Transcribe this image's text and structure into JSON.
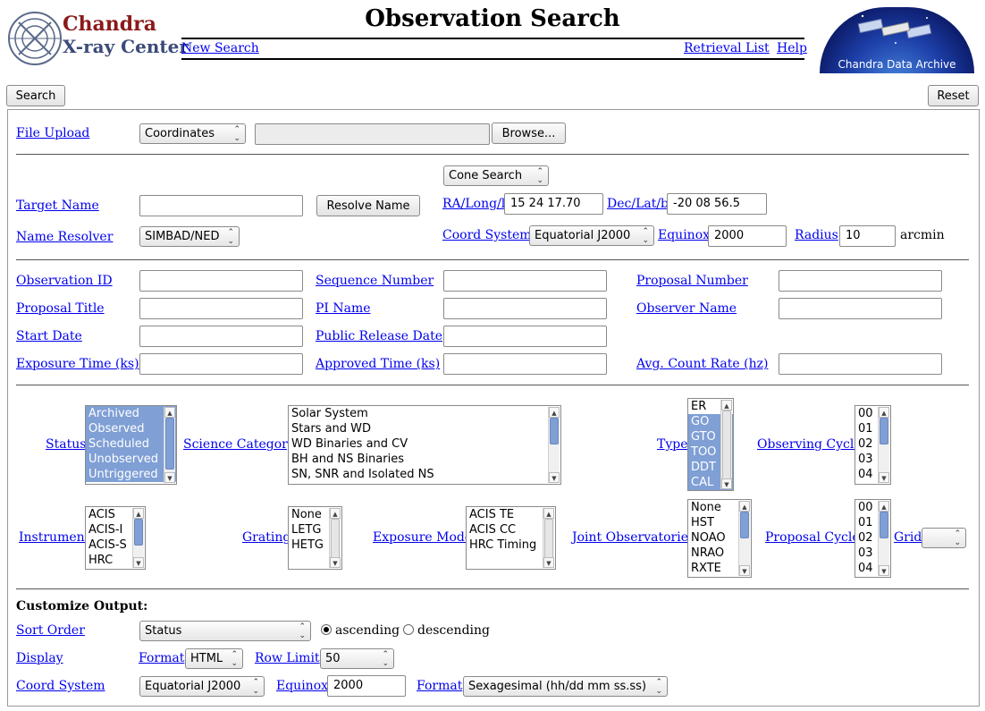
{
  "header": {
    "logo_line1": "Chandra",
    "logo_line2": "X-ray Center",
    "title": "Observation Search",
    "nav": {
      "new_search": "New Search",
      "retrieval_list": "Retrieval List",
      "help": "Help"
    },
    "archive_logo_text": "Chandra Data Archive"
  },
  "actions": {
    "search": "Search",
    "reset": "Reset"
  },
  "file_upload": {
    "label": "File Upload",
    "type_value": "Coordinates",
    "file_path": "",
    "browse": "Browse..."
  },
  "target": {
    "search_mode": "Cone Search",
    "target_name_label": "Target Name",
    "target_name_value": "",
    "resolve_button": "Resolve Name",
    "name_resolver_label": "Name Resolver",
    "name_resolver_value": "SIMBAD/NED",
    "ra_label": "RA/Long/l",
    "ra_value": "15 24 17.70",
    "dec_label": "Dec/Lat/b",
    "dec_value": "-20 08 56.5",
    "coord_system_label": "Coord System",
    "coord_system_value": "Equatorial J2000",
    "equinox_label": "Equinox",
    "equinox_value": "2000",
    "radius_label": "Radius",
    "radius_value": "10",
    "radius_unit": "arcmin"
  },
  "fields": {
    "observation_id": "Observation ID",
    "sequence_number": "Sequence Number",
    "proposal_number": "Proposal Number",
    "proposal_title": "Proposal Title",
    "pi_name": "PI Name",
    "observer_name": "Observer Name",
    "start_date": "Start Date",
    "public_release_date": "Public Release Date",
    "exposure_time": "Exposure Time (ks)",
    "approved_time": "Approved Time (ks)",
    "avg_count_rate": "Avg. Count Rate (hz)"
  },
  "filters": {
    "status": {
      "label": "Status",
      "options": [
        "Archived",
        "Observed",
        "Scheduled",
        "Unobserved",
        "Untriggered"
      ]
    },
    "science_category": {
      "label": "Science Category",
      "options": [
        "Solar System",
        "Stars and WD",
        "WD Binaries and CV",
        "BH and NS Binaries",
        "SN, SNR and Isolated NS"
      ]
    },
    "type": {
      "label": "Type",
      "options": [
        "ER",
        "GO",
        "GTO",
        "TOO",
        "DDT",
        "CAL"
      ]
    },
    "observing_cycle": {
      "label": "Observing Cycle",
      "options": [
        "00",
        "01",
        "02",
        "03",
        "04"
      ]
    },
    "instrument": {
      "label": "Instrument",
      "options": [
        "ACIS",
        "ACIS-I",
        "ACIS-S",
        "HRC"
      ]
    },
    "grating": {
      "label": "Grating",
      "options": [
        "None",
        "LETG",
        "HETG"
      ]
    },
    "exposure_mode": {
      "label": "Exposure Mode",
      "options": [
        "ACIS TE",
        "ACIS CC",
        "HRC Timing"
      ]
    },
    "joint_observatories": {
      "label": "Joint Observatories",
      "options": [
        "None",
        "HST",
        "NOAO",
        "NRAO",
        "RXTE"
      ]
    },
    "proposal_cycle": {
      "label": "Proposal Cycle",
      "options": [
        "00",
        "01",
        "02",
        "03",
        "04"
      ]
    },
    "grid": {
      "label": "Grid",
      "value": ""
    }
  },
  "output": {
    "heading": "Customize Output:",
    "sort_order_label": "Sort Order",
    "sort_value": "Status",
    "ascending": "ascending",
    "descending": "descending",
    "display_label": "Display",
    "format_label": "Format",
    "format_value": "HTML",
    "row_limit_label": "Row Limit",
    "row_limit_value": "50",
    "coord_system_label": "Coord System",
    "coord_system_value": "Equatorial J2000",
    "equinox_label": "Equinox",
    "equinox_value": "2000",
    "coord_format_label": "Format",
    "coord_format_value": "Sexagesimal (hh/dd mm ss.ss)"
  }
}
